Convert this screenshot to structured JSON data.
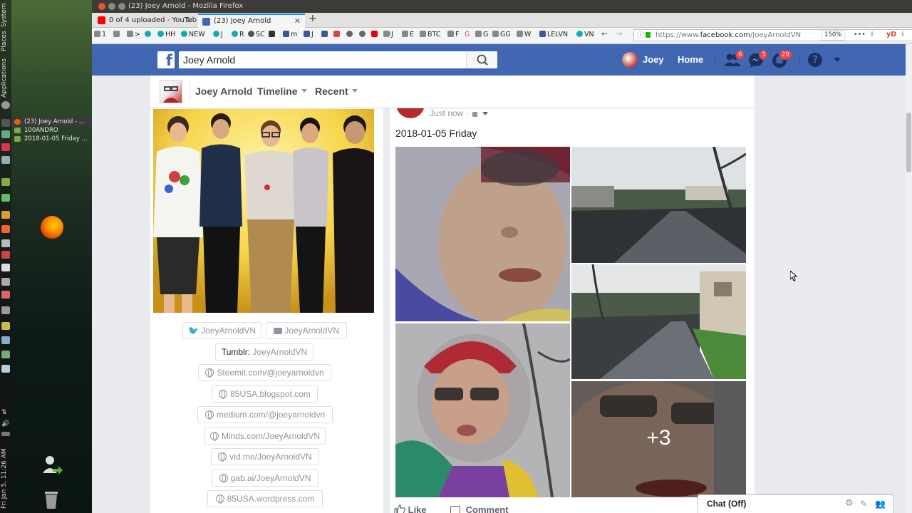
{
  "os": {
    "panel_labels": [
      "System",
      "Places",
      "Applications"
    ],
    "clock": "Fri Jan 5, 11:26 AM",
    "tasks": [
      {
        "label": "(23) Joey Arnold - ...",
        "active": true,
        "icon": "firefox-icon"
      },
      {
        "label": "100ANDRO",
        "active": false,
        "icon": "folder-icon"
      },
      {
        "label": "2018-01-05 Friday ...",
        "active": false,
        "icon": "folder-icon"
      }
    ]
  },
  "browser": {
    "window_title": "(23) Joey Arnold - Mozilla Firefox",
    "tabs": [
      {
        "label": "0 of 4 uploaded - YouTub",
        "icon": "youtube-icon",
        "active": false
      },
      {
        "label": "(23) Joey Arnold",
        "icon": "facebook-icon",
        "active": true
      }
    ],
    "new_tab": "+",
    "bookmarks": [
      "1",
      ">",
      "HH",
      "NEW",
      "J",
      "R",
      "SC",
      "m",
      "J",
      "J",
      "E",
      "BTC",
      "F",
      "G",
      "G",
      "GG",
      "W",
      "LELVN",
      "VN"
    ],
    "url_prefix": "https://www.",
    "url_domain": "facebook.com",
    "url_path": "/JoeyArnoldVN",
    "zoom": "150%",
    "menu": "•••",
    "extension": "yD"
  },
  "facebook": {
    "search_value": "Joey Arnold",
    "profile_name": "Joey",
    "home": "Home",
    "badges": {
      "friends": "6",
      "messages": "3",
      "notifications": "20"
    },
    "help": "?",
    "timeline": {
      "name": "Joey Arnold",
      "timeline_label": "Timeline",
      "recent_label": "Recent"
    },
    "social_links": {
      "twitter": "JoeyArnoldVN",
      "youtube": "JoeyArnoldVN",
      "tumblr_prefix": "Tumblr:",
      "tumblr": "JoeyArnoldVN",
      "websites": [
        "Steemit.com/@joeyarnoldvn",
        "85USA.blogspot.com",
        "medium.com/@joeyarnoldvn",
        "Minds.com/JoeyArnoldVN",
        "vid.me/JoeyArnoldVN",
        "gab.ai/JoeyArnoldVN",
        "85USA.wordpress.com"
      ]
    },
    "post": {
      "time": "Just now",
      "separator": "·",
      "text": "2018-01-05 Friday",
      "more_photos": "+3",
      "like": "Like",
      "comment": "Comment"
    },
    "chat": "Chat (Off)"
  }
}
